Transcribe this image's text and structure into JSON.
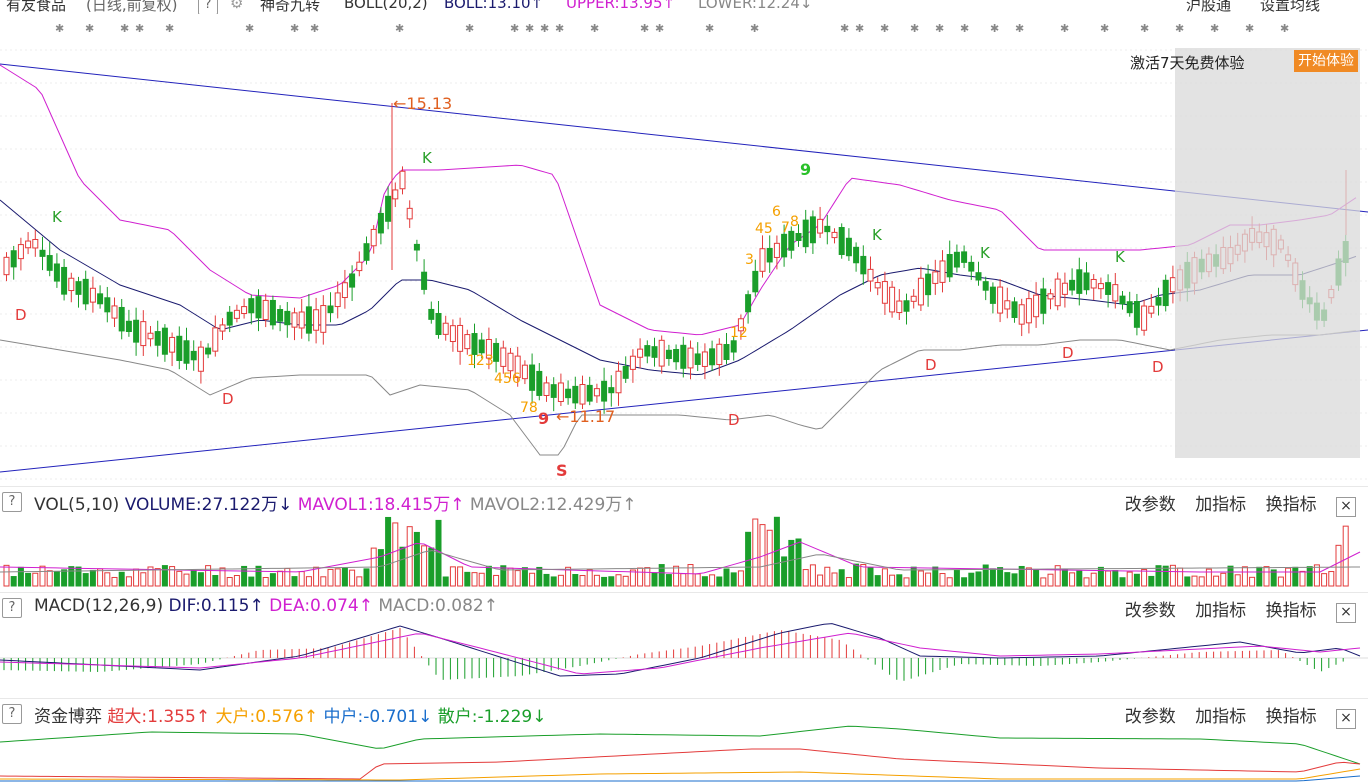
{
  "header": {
    "stock_name": "有友食品",
    "period": "(日线,前复权)",
    "indicator_name": "神奇九转",
    "boll_label": "BOLL(20,2)",
    "boll_mid": "BOLL:13.10",
    "boll_upper": "UPPER:13.95",
    "boll_lower": "LOWER:12.24",
    "arrow_up": "↑",
    "arrow_down": "↓",
    "right_link1": "沪股通",
    "right_link2": "设置均线",
    "question": "?"
  },
  "promo": {
    "text": "激活7天免费体验",
    "button": "开始体验"
  },
  "annotations": {
    "high_label": "15.13",
    "low_label": "11.17",
    "arrow_left": "←",
    "nine_top": "9",
    "nine_bottom": "9",
    "s_mark": "S",
    "k": "K",
    "d": "D",
    "seq_a": "123",
    "seq_b": "456",
    "seq_c": "78",
    "seq_12": "12",
    "seq_3": "3",
    "seq_45": "45",
    "seq_6": "6",
    "seq_7": "7",
    "seq_8": "8",
    "seq_1": "1"
  },
  "vol_panel": {
    "label": "VOL(5,10)",
    "volume": "VOLUME:27.122万",
    "mavol1": "MAVOL1:18.415万",
    "mavol2": "MAVOL2:12.429万",
    "arrow_down": "↓",
    "arrow_up": "↑",
    "btn1": "改参数",
    "btn2": "加指标",
    "btn3": "换指标",
    "close": "×"
  },
  "macd_panel": {
    "label": "MACD(12,26,9)",
    "dif": "DIF:0.115",
    "dea": "DEA:0.074",
    "macd": "MACD:0.082",
    "arrow_up": "↑",
    "btn1": "改参数",
    "btn2": "加指标",
    "btn3": "换指标",
    "close": "×"
  },
  "fund_panel": {
    "label": "资金博弈",
    "super": "超大:1.355",
    "large": "大户:0.576",
    "mid": "中户:-0.701",
    "retail": "散户:-1.229",
    "arrow_up": "↑",
    "arrow_down": "↓",
    "btn1": "改参数",
    "btn2": "加指标",
    "btn3": "换指标",
    "close": "×"
  },
  "colors": {
    "up": "#e33b3b",
    "down": "#1a9e2a",
    "boll_mid": "#1a1a6e",
    "boll_upper": "#d020d0",
    "boll_lower": "#888888",
    "trend": "#2222bb",
    "magic_nine": "#f5a000",
    "k_label": "#2aa02a",
    "d_label": "#e33b3b"
  }
}
